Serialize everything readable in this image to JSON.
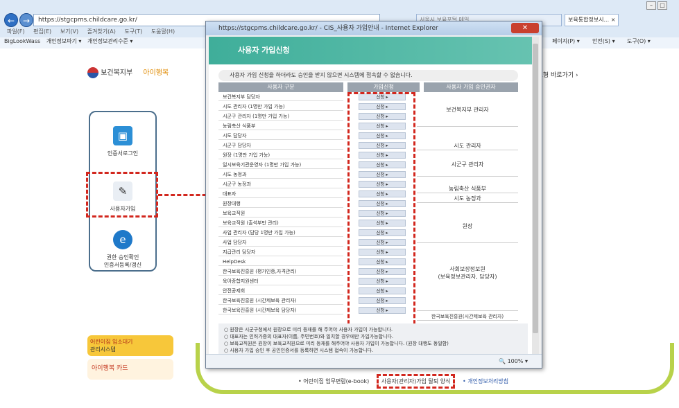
{
  "browser": {
    "url": "https://stgcpms.childcare.go.kr/",
    "tabs": [
      "보육통합정보시... ×"
    ],
    "tab_hidden": "서울시 보육포털 메일",
    "menu": [
      "파일(F)",
      "편집(E)",
      "보기(V)",
      "즐겨찾기(A)",
      "도구(T)",
      "도움말(H)"
    ],
    "favorites": [
      "BigLookWass",
      "개인정보파기 ▾",
      "개인정보관리수준 ▾"
    ],
    "toolbar_right": [
      "페이지(P) ▾",
      "안전(S) ▾",
      "도구(O) ▾"
    ]
  },
  "page": {
    "logo_ministry": "보건복지부",
    "logo_second": "아이행복",
    "shortcut": "종합모형 바로가기 ›",
    "side_items": [
      "인증서로그인",
      "사용자가입",
      "권한 승인확인\n인증서등록/갱신"
    ],
    "banner1_line1": "어린이집 입소대기",
    "banner1_line2": "관리시스템",
    "banner2": "아이행복 카드",
    "bottom_link1": "• 어린이집 업무편람(e-book)",
    "bottom_link2": "사용자(관리자)가입 탈퇴 양식",
    "bottom_link3": "• 개인정보처리방침"
  },
  "popup": {
    "title": "https://stgcpms.childcare.go.kr/ - CIS_사용자 가입안내 - Internet Explorer",
    "header": "사용자 가입신청",
    "notice": "사용자 가입 신청을 하더라도 승인을 받지 않으면 시스템에 접속할 수 없습니다.",
    "col_user_type": "사용자 구분",
    "col_apply": "가입신청",
    "col_approver": "사용자 가입 승인권자",
    "apply_label": "신청 ▸",
    "rows": [
      "보건복지부 담당자",
      "시도 관리자 (1명만 가입 가능)",
      "시군구 관리자 (1명만 가입 가능)",
      "농림축산 식품부",
      "시도 담당자",
      "시군구 담당자",
      "원장 (1명만 가입 가능)",
      "일시보육기관운영자 (1명만 가입 가능)",
      "시도 농정과",
      "시군구 농정과",
      "대표자",
      "원장대행",
      "보육교직원",
      "보육교직원 (출석부만 관리)",
      "사업 관리자 (담당 1명만 가입 가능)",
      "사업 담당자",
      "지급관리 담당자",
      "HelpDesk",
      "한국보육진흥원 (평가인증,자격관리)",
      "육아종합지원센터",
      "안전공제회",
      "한국보육진흥원 (시간제보육 관리자)",
      "한국보육진흥원 (시간제보육 담당자)"
    ],
    "approvers": [
      "보건복지부 관리자",
      "시도 관리자",
      "시군구 관리자",
      "농림축산 식품부",
      "시도 농정과",
      "원장",
      "사회보장정보원\n(보육정보관리자, 담당자)",
      "한국보육진흥원(시간제보육 관리자)"
    ],
    "notes": [
      "○ 원장은 시군구청에서 원장으로 미리 등재를 해 주어야 사용자 가입이 가능합니다.",
      "○ 대표자는 인허가증의 대표자(이름, 주민번호)와 일치할 경우에만 가입가능합니다.",
      "○ 보육교직원은 원장이 보육교직원으로 미리 등재를 해주어야 사용자 가입이 가능합니다. (원장 대행도 동일함)",
      "○ 사용자 가입 승인 후 공인인증서를 등록하면 시스템 접속이 가능합니다."
    ],
    "zoom": "🔍 100% ▾"
  }
}
